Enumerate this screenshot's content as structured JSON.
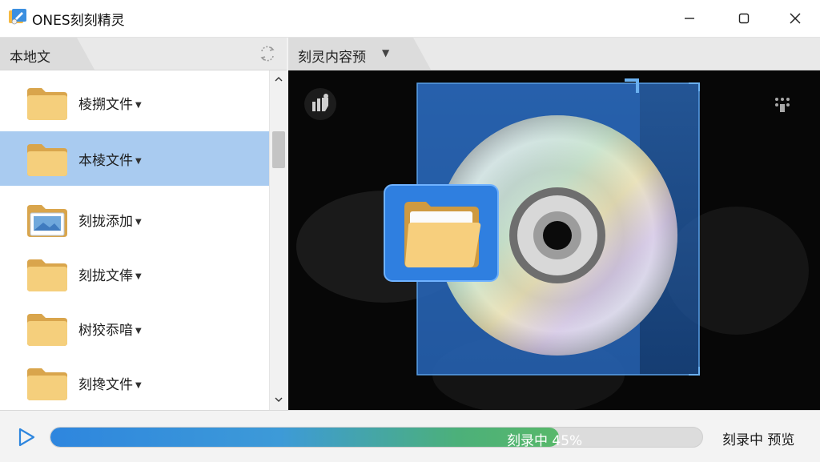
{
  "window": {
    "title": "ONES刻刻精灵",
    "controls": [
      "minimize",
      "maximize",
      "close"
    ]
  },
  "left_panel": {
    "tab_label": "本地文",
    "items": [
      {
        "label": "棱搠文件",
        "icon": "folder-icon",
        "selected": false
      },
      {
        "label": "本棱文件",
        "icon": "folder-icon",
        "selected": true
      },
      {
        "label": "刻拢添加",
        "icon": "folder-image-icon",
        "selected": false
      },
      {
        "label": "刻拢文俸",
        "icon": "folder-icon",
        "selected": false
      },
      {
        "label": "树狡忝喑",
        "icon": "folder-icon",
        "selected": false
      },
      {
        "label": "刻搀文件",
        "icon": "folder-icon",
        "selected": false
      }
    ]
  },
  "right_panel": {
    "tab_label": "刻灵内容预"
  },
  "bottom": {
    "progress_label": "刻录中",
    "progress_percent_text": "45%",
    "progress_value": 0.78,
    "preview_label": "刻录中 预览"
  },
  "colors": {
    "accent": "#2e86de",
    "selection": "#a9cbf0",
    "progress_end": "#58b86a"
  }
}
